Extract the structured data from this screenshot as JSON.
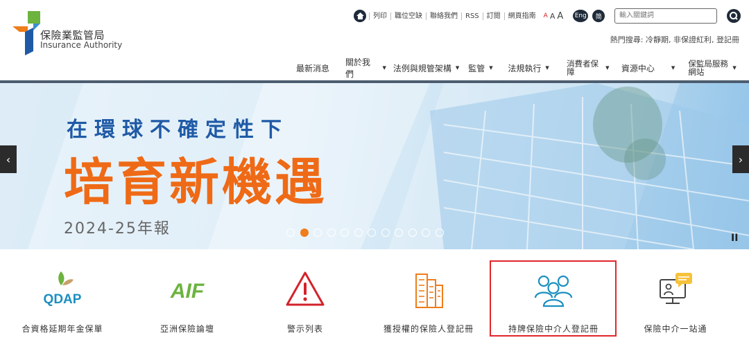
{
  "header": {
    "logo_zh": "保險業監管局",
    "logo_en": "Insurance Authority",
    "top_links": [
      "列印",
      "職位空缺",
      "聯絡我們",
      "RSS",
      "訂閱",
      "網頁指南"
    ],
    "font_sizes": [
      "A",
      "A",
      "A"
    ],
    "lang_en": "Eng",
    "lang_sc": "简",
    "search_placeholder": "輸入關鍵詞",
    "hot_search": "熱門搜尋: 冷靜期, 非保證紅利, 登記冊"
  },
  "nav": {
    "items": [
      {
        "label": "最新消息",
        "dropdown": false
      },
      {
        "label": "關於我們",
        "dropdown": true
      },
      {
        "label": "法例與規管架構",
        "dropdown": true
      },
      {
        "label": "監管",
        "dropdown": true
      },
      {
        "label": "法規執行",
        "dropdown": true
      },
      {
        "label": "消費者保障",
        "dropdown": true
      },
      {
        "label": "資源中心",
        "dropdown": true
      },
      {
        "label": "保監局服務網站",
        "dropdown": true
      }
    ]
  },
  "banner": {
    "line1": "在環球不確定性下",
    "line2": "培育新機遇",
    "line3": "2024-25年報",
    "prev": "‹",
    "next": "›",
    "pause": "II",
    "slide_count": 12,
    "active_slide": 2,
    "colors": {
      "blue": "#1f5aa6",
      "orange": "#ef6a16"
    }
  },
  "quick_links": [
    {
      "label": "合資格延期年金保單",
      "logo_text": "QDAP",
      "icon": "qdap-logo"
    },
    {
      "label": "亞洲保險論壇",
      "logo_text": "AIF",
      "icon": "aif-logo"
    },
    {
      "label": "警示列表",
      "icon": "warning-icon"
    },
    {
      "label": "獲授權的保險人登記冊",
      "icon": "building-icon"
    },
    {
      "label": "持牌保險中介人登記冊",
      "icon": "people-icon",
      "highlighted": true
    },
    {
      "label": "保險中介一站通",
      "icon": "chat-monitor-icon"
    }
  ]
}
